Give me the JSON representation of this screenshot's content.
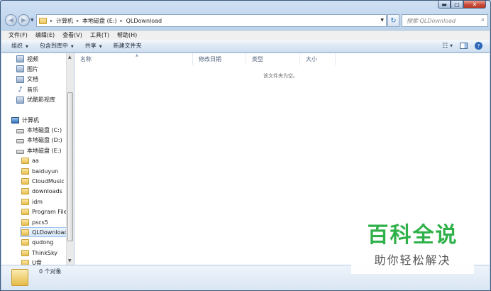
{
  "title_bar": {
    "min": "▬",
    "max": "□",
    "close": "✕"
  },
  "address": {
    "crumbs": [
      "计算机",
      "本地磁盘 (E:)",
      "QLDownload"
    ],
    "separator": "▸"
  },
  "search": {
    "placeholder": "搜索 QLDownload"
  },
  "menu": [
    "文件(F)",
    "编辑(E)",
    "查看(V)",
    "工具(T)",
    "帮助(H)"
  ],
  "commands": [
    {
      "label": "组织",
      "has_dropdown": true
    },
    {
      "label": "包含到库中",
      "has_dropdown": true
    },
    {
      "label": "共享",
      "has_dropdown": true
    },
    {
      "label": "新建文件夹",
      "has_dropdown": false
    }
  ],
  "nav_tree": [
    {
      "label": "视频",
      "icon": "library-icon",
      "indent": 0
    },
    {
      "label": "图片",
      "icon": "library-icon",
      "indent": 0
    },
    {
      "label": "文档",
      "icon": "library-icon",
      "indent": 0
    },
    {
      "label": "音乐",
      "icon": "music-icon",
      "indent": 0
    },
    {
      "label": "优酷影视库",
      "icon": "library-icon",
      "indent": 0
    },
    {
      "label": "计算机",
      "icon": "computer-icon",
      "indent": -1
    },
    {
      "label": "本地磁盘 (C:)",
      "icon": "drive-icon",
      "indent": 0
    },
    {
      "label": "本地磁盘 (D:)",
      "icon": "drive-icon",
      "indent": 0
    },
    {
      "label": "本地磁盘 (E:)",
      "icon": "drive-icon",
      "indent": 0
    },
    {
      "label": "aa",
      "icon": "folder-icon",
      "indent": 1
    },
    {
      "label": "baiduyun",
      "icon": "folder-icon",
      "indent": 1
    },
    {
      "label": "CloudMusic",
      "icon": "folder-icon",
      "indent": 1
    },
    {
      "label": "downloads",
      "icon": "folder-icon",
      "indent": 1
    },
    {
      "label": "idm",
      "icon": "folder-icon",
      "indent": 1
    },
    {
      "label": "Program Files",
      "icon": "folder-icon",
      "indent": 1
    },
    {
      "label": "pscs5",
      "icon": "folder-icon",
      "indent": 1
    },
    {
      "label": "QLDownload",
      "icon": "folder-icon",
      "indent": 1,
      "selected": true
    },
    {
      "label": "qudong",
      "icon": "folder-icon",
      "indent": 1
    },
    {
      "label": "ThinkSky",
      "icon": "folder-icon",
      "indent": 1
    },
    {
      "label": "U盘",
      "icon": "folder-icon",
      "indent": 1
    }
  ],
  "columns": [
    "名称",
    "修改日期",
    "类型",
    "大小"
  ],
  "empty_message": "该文件夹为空。",
  "status": {
    "item_count": "0 个对象"
  },
  "watermark": {
    "title": "百科全说",
    "subtitle": "助你轻松解决"
  }
}
